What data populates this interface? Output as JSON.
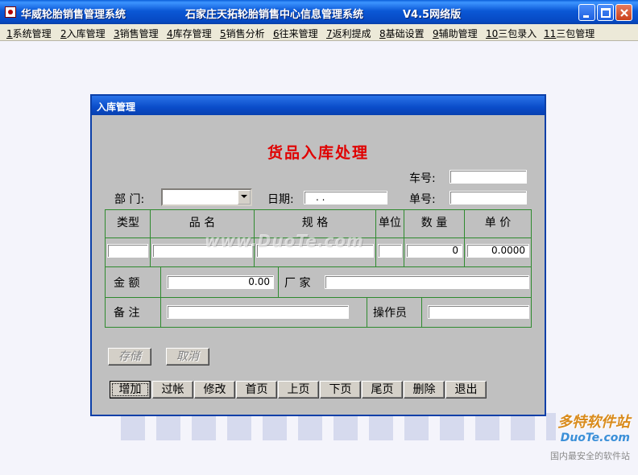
{
  "window": {
    "app_name": "华威轮胎销售管理系统",
    "subtitle": "石家庄天拓轮胎销售中心信息管理系统",
    "version": "V4.5网络版"
  },
  "menu": [
    {
      "num": "1",
      "label": "系统管理"
    },
    {
      "num": "2",
      "label": "入库管理"
    },
    {
      "num": "3",
      "label": "销售管理"
    },
    {
      "num": "4",
      "label": "库存管理"
    },
    {
      "num": "5",
      "label": "销售分析"
    },
    {
      "num": "6",
      "label": "往来管理"
    },
    {
      "num": "7",
      "label": "返利提成"
    },
    {
      "num": "8",
      "label": "基础设置"
    },
    {
      "num": "9",
      "label": "辅助管理"
    },
    {
      "num": "10",
      "label": "三包录入"
    },
    {
      "num": "11",
      "label": "三包管理"
    }
  ],
  "dialog": {
    "title": "入库管理",
    "heading": "货品入库处理",
    "car_no_label": "车号:",
    "car_no_value": "",
    "dept_label": "部  门:",
    "dept_value": "",
    "date_label": "日期:",
    "date_value": ". .",
    "order_no_label": "单号:",
    "order_no_value": "",
    "columns": [
      "类型",
      "品  名",
      "规  格",
      "单位",
      "数  量",
      "单  价"
    ],
    "row": {
      "type": "",
      "name": "",
      "spec": "",
      "unit": "",
      "qty": "0",
      "price": "0.0000"
    },
    "amount_label": "金  额",
    "amount_value": "0.00",
    "maker_label": "厂  家",
    "maker_value": "",
    "remark_label": "备  注",
    "remark_value": "",
    "operator_label": "操作员",
    "operator_value": "",
    "save_label": "存储",
    "cancel_label": "取消",
    "nav_buttons": [
      "增加",
      "过帐",
      "修改",
      "首页",
      "上页",
      "下页",
      "尾页",
      "删除",
      "退出"
    ]
  },
  "watermark": {
    "site": "www.DuoTe.com",
    "logo_brand": "多特软件站",
    "logo_url": "DuoTe.com",
    "logo_slogan": "国内最安全的软件站"
  },
  "colors": {
    "heading": "#e00000",
    "grid_line": "#2f8a2f",
    "titlebar": "#0a5fd8"
  }
}
